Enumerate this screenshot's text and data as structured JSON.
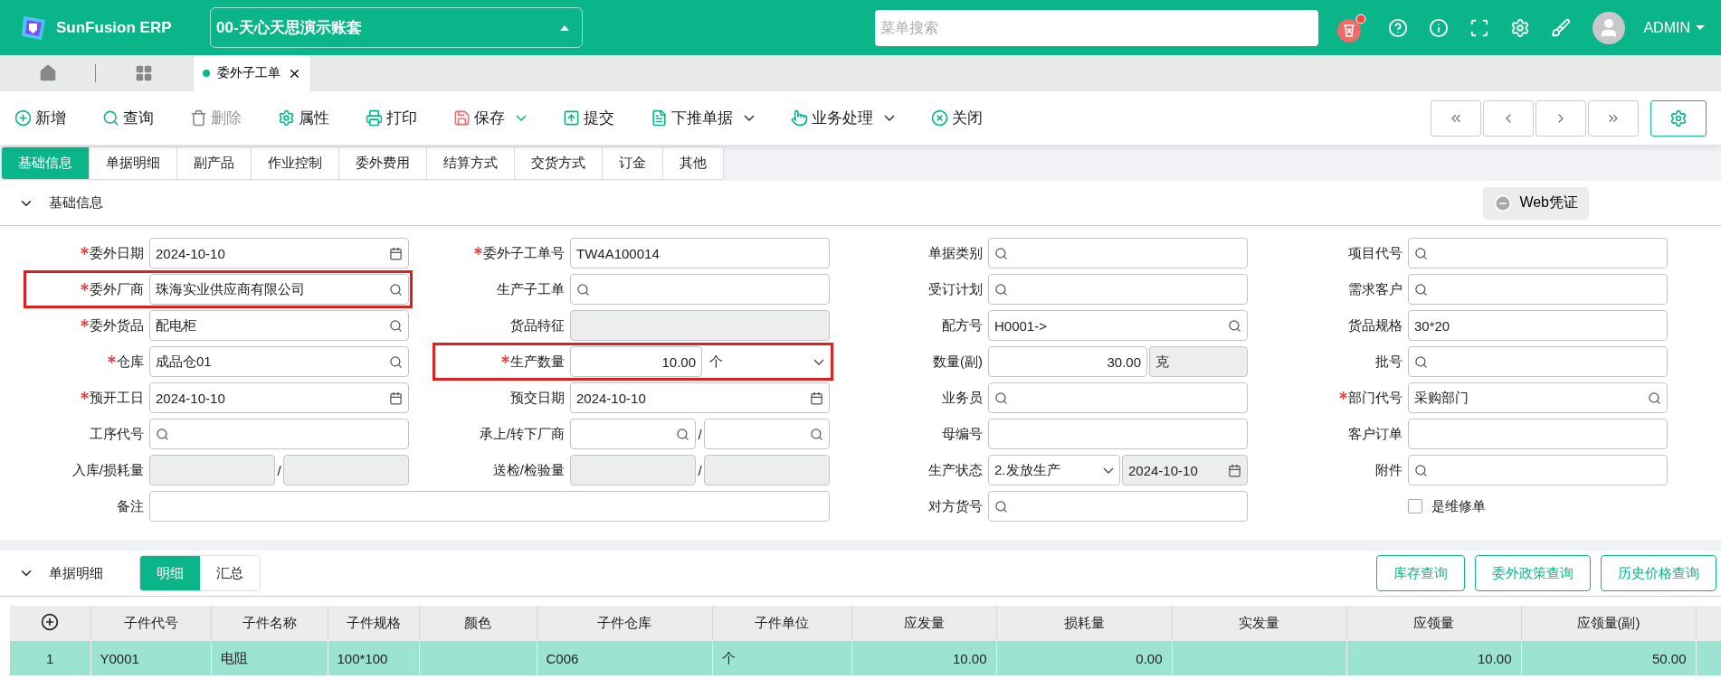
{
  "header": {
    "brand": "SunFusion ERP",
    "account": "00-天心天思演示账套",
    "search": {
      "placeholder": "菜单搜索"
    },
    "user": "ADMIN"
  },
  "page_tabs": [
    {
      "label": "委外子工单",
      "selected": true
    }
  ],
  "toolbar": [
    {
      "kind": "add",
      "label": "新增",
      "disabled": false,
      "dropdown": false
    },
    {
      "kind": "query",
      "label": "查询",
      "disabled": false,
      "dropdown": false
    },
    {
      "kind": "delete",
      "label": "删除",
      "disabled": true,
      "dropdown": false
    },
    {
      "kind": "properties",
      "label": "属性",
      "disabled": false,
      "dropdown": false
    },
    {
      "kind": "print",
      "label": "打印",
      "disabled": false,
      "dropdown": false
    },
    {
      "kind": "save",
      "label": "保存",
      "disabled": false,
      "dropdown": true
    },
    {
      "kind": "submit",
      "label": "提交",
      "disabled": false,
      "dropdown": false
    },
    {
      "kind": "push",
      "label": "下推单据",
      "disabled": false,
      "dropdown": true
    },
    {
      "kind": "business",
      "label": "业务处理",
      "disabled": false,
      "dropdown": true
    },
    {
      "kind": "close",
      "label": "关闭",
      "disabled": false,
      "dropdown": false
    }
  ],
  "form_tabs": [
    {
      "label": "基础信息",
      "selected": true
    },
    {
      "label": "单据明细",
      "selected": false
    },
    {
      "label": "副产品",
      "selected": false
    },
    {
      "label": "作业控制",
      "selected": false
    },
    {
      "label": "委外费用",
      "selected": false
    },
    {
      "label": "结算方式",
      "selected": false
    },
    {
      "label": "交货方式",
      "selected": false
    },
    {
      "label": "订金",
      "selected": false
    },
    {
      "label": "其他",
      "selected": false
    }
  ],
  "section": {
    "title": "基础信息",
    "expanded": true,
    "voucher_button": "Web凭证"
  },
  "form": {
    "fields": [
      {
        "kind": "date",
        "label": "委外日期",
        "required": true,
        "highlighted": false,
        "value": "2024-10-10"
      },
      {
        "kind": "text",
        "label": "委外子工单号",
        "required": true,
        "highlighted": false,
        "value": "TW4A100014"
      },
      {
        "kind": "search",
        "label": "单据类别",
        "required": false,
        "highlighted": false
      },
      {
        "kind": "search",
        "label": "项目代号",
        "required": false,
        "highlighted": false
      },
      {
        "kind": "search",
        "label": "委外厂商",
        "required": true,
        "highlighted": true,
        "value": "珠海实业供应商有限公司"
      },
      {
        "kind": "search",
        "label": "生产子工单",
        "required": false,
        "highlighted": false
      },
      {
        "kind": "search",
        "label": "受订计划",
        "required": false,
        "highlighted": false
      },
      {
        "kind": "search",
        "label": "需求客户",
        "required": false,
        "highlighted": false
      },
      {
        "kind": "search",
        "label": "委外货品",
        "required": true,
        "highlighted": false,
        "value": "配电柜"
      },
      {
        "kind": "disabled",
        "label": "货品特征",
        "required": false,
        "highlighted": false
      },
      {
        "kind": "search",
        "label": "配方号",
        "required": false,
        "highlighted": false,
        "value": "H0001->"
      },
      {
        "kind": "text",
        "label": "货品规格",
        "required": false,
        "highlighted": false,
        "value": "30*20"
      },
      {
        "kind": "search",
        "label": "仓库",
        "required": true,
        "highlighted": false,
        "value": "成品仓01"
      },
      {
        "kind": "quantity",
        "label": "生产数量",
        "required": true,
        "highlighted": true,
        "value": "10.00",
        "unit": "个"
      },
      {
        "kind": "number-unit",
        "label": "数量(副)",
        "required": false,
        "highlighted": false,
        "value": "30.00",
        "unit": "克"
      },
      {
        "kind": "search",
        "label": "批号",
        "required": false,
        "highlighted": false
      },
      {
        "kind": "date",
        "label": "预开工日",
        "required": true,
        "highlighted": false,
        "value": "2024-10-10"
      },
      {
        "kind": "date",
        "label": "预交日期",
        "required": false,
        "highlighted": false,
        "value": "2024-10-10"
      },
      {
        "kind": "search",
        "label": "业务员",
        "required": false,
        "highlighted": false
      },
      {
        "kind": "search",
        "label": "部门代号",
        "required": true,
        "highlighted": false,
        "value": "采购部门"
      },
      {
        "kind": "search",
        "label": "工序代号",
        "required": false,
        "highlighted": false
      },
      {
        "kind": "search-pair",
        "label": "承上/转下厂商",
        "required": false,
        "highlighted": false,
        "separator": "/"
      },
      {
        "kind": "text",
        "label": "母编号",
        "required": false,
        "highlighted": false
      },
      {
        "kind": "text",
        "label": "客户订单",
        "required": false,
        "highlighted": false
      },
      {
        "kind": "disabled-pair",
        "label": "入库/损耗量",
        "required": false,
        "highlighted": false,
        "separator": "/"
      },
      {
        "kind": "disabled-pair",
        "label": "送检/检验量",
        "required": false,
        "highlighted": false,
        "separator": "/"
      },
      {
        "kind": "select-date",
        "label": "生产状态",
        "required": false,
        "highlighted": false,
        "value": "2.发放生产",
        "date": "2024-10-10"
      },
      {
        "kind": "search",
        "label": "附件",
        "required": false,
        "highlighted": false
      },
      {
        "kind": "wide",
        "label": "备注",
        "required": false,
        "highlighted": false
      },
      {
        "kind": "search",
        "label": "对方货号",
        "required": false,
        "highlighted": false
      },
      {
        "kind": "checkbox",
        "label": "是维修单",
        "checked": false
      }
    ]
  },
  "detail": {
    "title": "单据明细",
    "expanded": true,
    "views": [
      {
        "label": "明细",
        "selected": true
      },
      {
        "label": "汇总",
        "selected": false
      }
    ],
    "buttons": [
      "库存查询",
      "委外政策查询",
      "历史价格查询"
    ],
    "table": {
      "columns": [
        {
          "kind": "index"
        },
        {
          "kind": "text",
          "label": "子件代号"
        },
        {
          "kind": "text",
          "label": "子件名称"
        },
        {
          "kind": "text",
          "label": "子件规格"
        },
        {
          "kind": "text",
          "label": "颜色"
        },
        {
          "kind": "text",
          "label": "子件仓库"
        },
        {
          "kind": "text",
          "label": "子件单位"
        },
        {
          "kind": "number",
          "label": "应发量"
        },
        {
          "kind": "number",
          "label": "损耗量"
        },
        {
          "kind": "number",
          "label": "实发量"
        },
        {
          "kind": "number",
          "label": "应领量"
        },
        {
          "kind": "number",
          "label": "应领量(副)"
        }
      ],
      "rows": [
        {
          "selected": true,
          "cells": [
            "1",
            "Y0001",
            "电阻",
            "100*100",
            null,
            "C006",
            "个",
            "10.00",
            "0.00",
            null,
            "10.00",
            "50.00"
          ]
        }
      ]
    }
  }
}
